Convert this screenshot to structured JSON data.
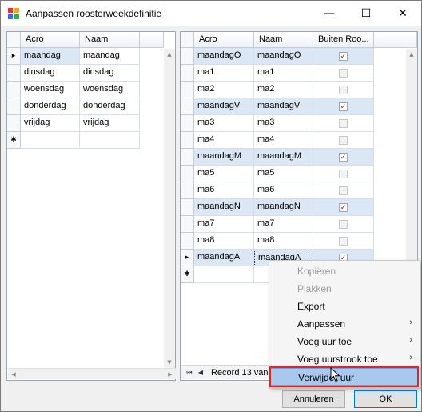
{
  "window": {
    "title": "Aanpassen roosterweekdefinitie",
    "minimize": "—",
    "maximize": "☐",
    "close": "✕"
  },
  "left_grid": {
    "columns": [
      "Acro",
      "Naam"
    ],
    "rows": [
      [
        "maandag",
        "maandag"
      ],
      [
        "dinsdag",
        "dinsdag"
      ],
      [
        "woensdag",
        "woensdag"
      ],
      [
        "donderdag",
        "donderdag"
      ],
      [
        "vrijdag",
        "vrijdag"
      ]
    ],
    "new_row_marker": "✱",
    "current_row_marker": "▸"
  },
  "right_grid": {
    "columns": [
      "Acro",
      "Naam",
      "Buiten Roo..."
    ],
    "rows": [
      {
        "acro": "maandagO",
        "naam": "maandagO",
        "checked": true
      },
      {
        "acro": "ma1",
        "naam": "ma1",
        "checked": false
      },
      {
        "acro": "ma2",
        "naam": "ma2",
        "checked": false
      },
      {
        "acro": "maandagV",
        "naam": "maandagV",
        "checked": true
      },
      {
        "acro": "ma3",
        "naam": "ma3",
        "checked": false
      },
      {
        "acro": "ma4",
        "naam": "ma4",
        "checked": false
      },
      {
        "acro": "maandagM",
        "naam": "maandagM",
        "checked": true
      },
      {
        "acro": "ma5",
        "naam": "ma5",
        "checked": false
      },
      {
        "acro": "ma6",
        "naam": "ma6",
        "checked": false
      },
      {
        "acro": "maandagN",
        "naam": "maandagN",
        "checked": true
      },
      {
        "acro": "ma7",
        "naam": "ma7",
        "checked": false
      },
      {
        "acro": "ma8",
        "naam": "ma8",
        "checked": false
      },
      {
        "acro": "maandagA",
        "naam": "maandagA",
        "checked": true
      }
    ],
    "new_row_marker": "✱",
    "current_row_marker": "▸",
    "navigator_text": "Record 13 van"
  },
  "context_menu": {
    "items": [
      {
        "label": "Kopiëren",
        "enabled": false,
        "submenu": false
      },
      {
        "label": "Plakken",
        "enabled": false,
        "submenu": false
      },
      {
        "label": "Export",
        "enabled": true,
        "submenu": false
      },
      {
        "label": "Aanpassen",
        "enabled": true,
        "submenu": true
      },
      {
        "label": "Voeg uur toe",
        "enabled": true,
        "submenu": true
      },
      {
        "label": "Voeg uurstrook toe",
        "enabled": true,
        "submenu": true
      },
      {
        "label": "Verwijder uur",
        "enabled": true,
        "submenu": false,
        "highlighted": true
      }
    ],
    "submenu_arrow": "›"
  },
  "buttons": {
    "cancel": "Annuleren",
    "ok": "OK"
  },
  "colors": {
    "row_highlight": "#dce7f5",
    "menu_highlight": "#a8c8ee",
    "annotation_red": "#e0242c",
    "ok_border": "#0078d7"
  }
}
